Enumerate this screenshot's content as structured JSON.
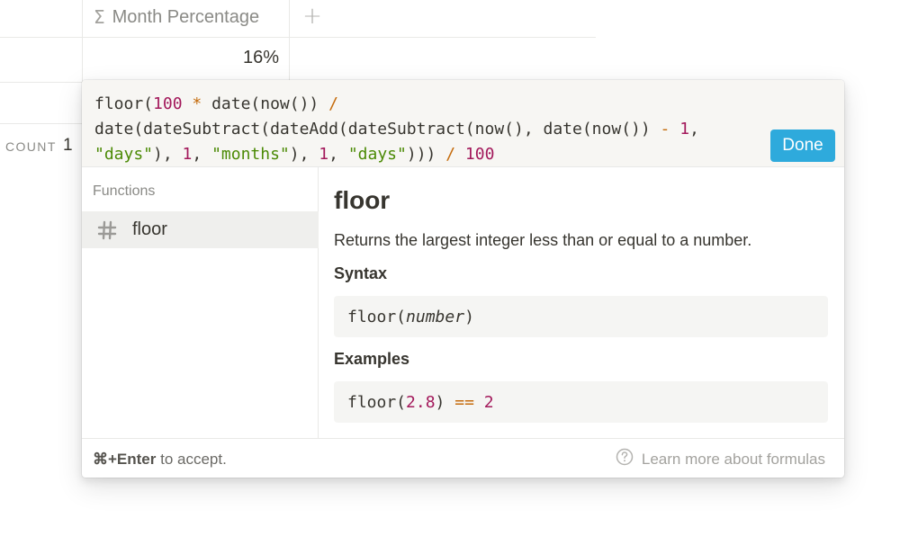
{
  "table": {
    "column_header": "Month Percentage",
    "column_icon": "sigma-icon",
    "add_column_icon": "plus-icon",
    "cell_value": "16%",
    "count_label": "COUNT",
    "count_value": "1"
  },
  "formula_editor": {
    "lines": [
      [
        {
          "t": "floor(",
          "k": "fn"
        },
        {
          "t": "100",
          "k": "num"
        },
        {
          "t": " * ",
          "k": "op"
        },
        {
          "t": "date(now()) ",
          "k": "fn"
        },
        {
          "t": "/",
          "k": "op"
        }
      ],
      [
        {
          "t": "date(dateSubtract(dateAdd(dateSubtract(now(), date(now()) ",
          "k": "fn"
        },
        {
          "t": "-",
          "k": "op"
        },
        {
          "t": " ",
          "k": "fn"
        },
        {
          "t": "1",
          "k": "num"
        },
        {
          "t": ",",
          "k": "fn"
        }
      ],
      [
        {
          "t": "\"days\"",
          "k": "str"
        },
        {
          "t": "), ",
          "k": "fn"
        },
        {
          "t": "1",
          "k": "num"
        },
        {
          "t": ", ",
          "k": "fn"
        },
        {
          "t": "\"months\"",
          "k": "str"
        },
        {
          "t": "), ",
          "k": "fn"
        },
        {
          "t": "1",
          "k": "num"
        },
        {
          "t": ", ",
          "k": "fn"
        },
        {
          "t": "\"days\"",
          "k": "str"
        },
        {
          "t": "))) ",
          "k": "fn"
        },
        {
          "t": "/",
          "k": "op"
        },
        {
          "t": " ",
          "k": "fn"
        },
        {
          "t": "100",
          "k": "num"
        }
      ]
    ],
    "done_label": "Done"
  },
  "functions_pane": {
    "heading": "Functions",
    "selected_item": {
      "icon": "hash-icon",
      "label": "floor"
    }
  },
  "doc": {
    "title": "floor",
    "description": "Returns the largest integer less than or equal to a number.",
    "syntax_heading": "Syntax",
    "syntax_fn": "floor(",
    "syntax_arg": "number",
    "syntax_close": ")",
    "examples_heading": "Examples",
    "example_fn": "floor(",
    "example_arg": "2.8",
    "example_close": ") ",
    "example_op": "==",
    "example_result": "2"
  },
  "footer": {
    "shortcut": "⌘+Enter",
    "hint_rest": " to accept.",
    "help_icon": "question-circle-icon",
    "learn_more": "Learn more about formulas"
  },
  "colors": {
    "accent": "#2eaadc",
    "number": "#a3195b",
    "operator": "#c56b0c",
    "string": "#4b8a05"
  }
}
